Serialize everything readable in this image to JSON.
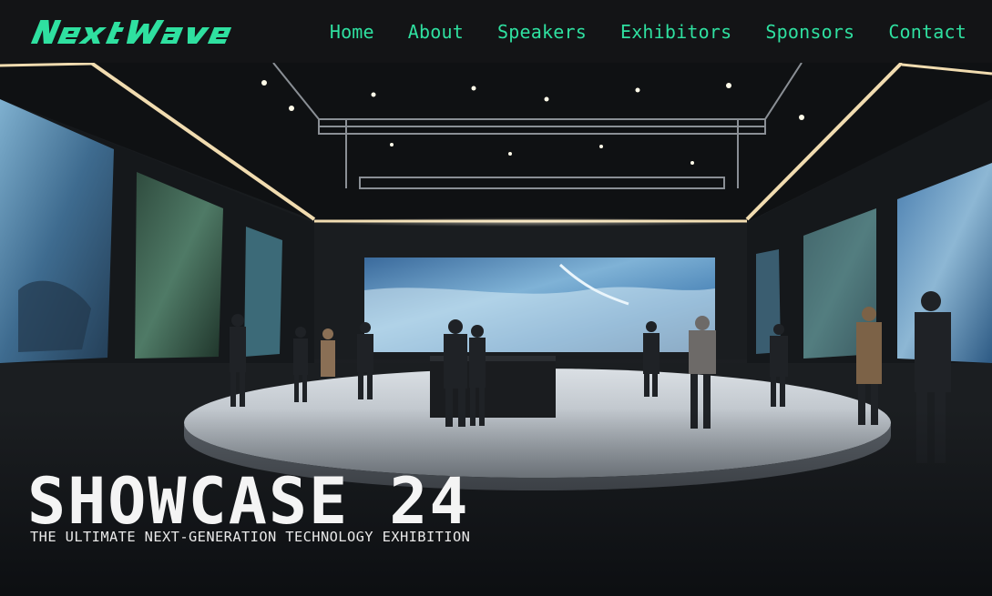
{
  "brand": {
    "logo_text": "NextWave",
    "accent_color": "#2fe0a0"
  },
  "nav": {
    "items": [
      {
        "label": "Home"
      },
      {
        "label": "About"
      },
      {
        "label": "Speakers"
      },
      {
        "label": "Exhibitors"
      },
      {
        "label": "Sponsors"
      },
      {
        "label": "Contact"
      }
    ]
  },
  "hero": {
    "title": "SHOWCASE 24",
    "subtitle": "THE ULTIMATE NEXT-GENERATION TECHNOLOGY EXHIBITION"
  }
}
